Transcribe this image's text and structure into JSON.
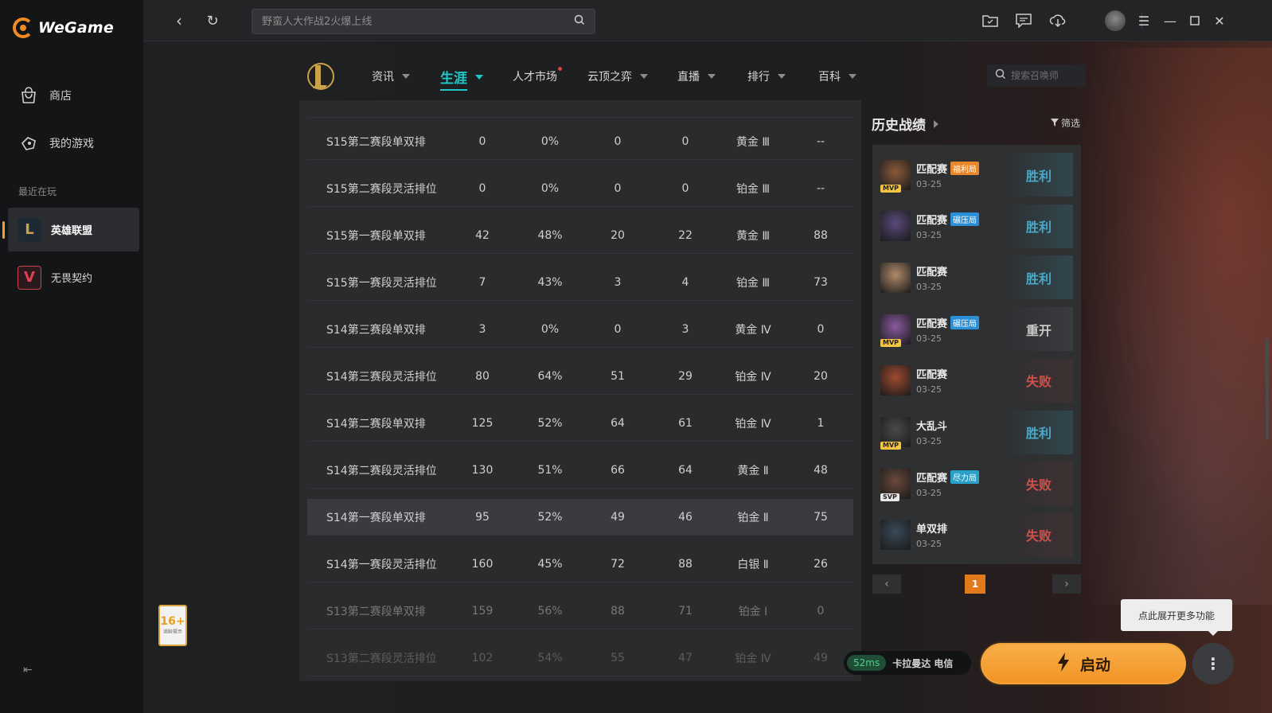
{
  "app": {
    "logo_text": "WeGame"
  },
  "sidebar": {
    "items": [
      {
        "label": "商店",
        "icon": "shop-bag-icon"
      },
      {
        "label": "我的游戏",
        "icon": "gamepad-icon"
      }
    ],
    "recent_title": "最近在玩",
    "games": [
      {
        "label": "英雄联盟",
        "icon": "lol-logo-icon",
        "active": true
      },
      {
        "label": "无畏契约",
        "icon": "valorant-logo-icon",
        "active": false
      }
    ]
  },
  "topbar": {
    "search_placeholder": "野蛮人大作战2火爆上线"
  },
  "lol_nav": {
    "tabs": [
      {
        "label": "资讯",
        "active": false
      },
      {
        "label": "生涯",
        "active": true
      },
      {
        "label": "人才市场",
        "active": false,
        "dot": true
      },
      {
        "label": "云顶之弈",
        "active": false
      },
      {
        "label": "直播",
        "active": false
      },
      {
        "label": "排行",
        "active": false
      },
      {
        "label": "百科",
        "active": false
      }
    ],
    "summoner_search_placeholder": "搜索召唤师"
  },
  "ranked_table": {
    "rows": [
      {
        "season": "S15第二赛段单双排",
        "games": "0",
        "winrate": "0%",
        "wins": "0",
        "losses": "0",
        "tier": "黄金 Ⅲ",
        "lp": "--"
      },
      {
        "season": "S15第二赛段灵活排位",
        "games": "0",
        "winrate": "0%",
        "wins": "0",
        "losses": "0",
        "tier": "铂金 Ⅲ",
        "lp": "--"
      },
      {
        "season": "S15第一赛段单双排",
        "games": "42",
        "winrate": "48%",
        "wins": "20",
        "losses": "22",
        "tier": "黄金 Ⅲ",
        "lp": "88"
      },
      {
        "season": "S15第一赛段灵活排位",
        "games": "7",
        "winrate": "43%",
        "wins": "3",
        "losses": "4",
        "tier": "铂金 Ⅲ",
        "lp": "73"
      },
      {
        "season": "S14第三赛段单双排",
        "games": "3",
        "winrate": "0%",
        "wins": "0",
        "losses": "3",
        "tier": "黄金 Ⅳ",
        "lp": "0"
      },
      {
        "season": "S14第三赛段灵活排位",
        "games": "80",
        "winrate": "64%",
        "wins": "51",
        "losses": "29",
        "tier": "铂金 Ⅳ",
        "lp": "20"
      },
      {
        "season": "S14第二赛段单双排",
        "games": "125",
        "winrate": "52%",
        "wins": "64",
        "losses": "61",
        "tier": "铂金 Ⅳ",
        "lp": "1"
      },
      {
        "season": "S14第二赛段灵活排位",
        "games": "130",
        "winrate": "51%",
        "wins": "66",
        "losses": "64",
        "tier": "黄金 Ⅱ",
        "lp": "48"
      },
      {
        "season": "S14第一赛段单双排",
        "games": "95",
        "winrate": "52%",
        "wins": "49",
        "losses": "46",
        "tier": "铂金 Ⅱ",
        "lp": "75"
      },
      {
        "season": "S14第一赛段灵活排位",
        "games": "160",
        "winrate": "45%",
        "wins": "72",
        "losses": "88",
        "tier": "白银 Ⅱ",
        "lp": "26"
      },
      {
        "season": "S13第二赛段单双排",
        "games": "159",
        "winrate": "56%",
        "wins": "88",
        "losses": "71",
        "tier": "铂金 Ⅰ",
        "lp": "0"
      },
      {
        "season": "S13第二赛段灵活排位",
        "games": "102",
        "winrate": "54%",
        "wins": "55",
        "losses": "47",
        "tier": "铂金 Ⅳ",
        "lp": "49"
      }
    ]
  },
  "history": {
    "title": "历史战绩",
    "filter_label": "筛选",
    "matches": [
      {
        "mode": "匹配赛",
        "tag": "福利局",
        "tag_color": "#e8862a",
        "date": "03-25",
        "badge": "MVP",
        "result": "胜利",
        "result_type": "win",
        "champ_color": "#8a5a3a"
      },
      {
        "mode": "匹配赛",
        "tag": "碾压局",
        "tag_color": "#2a8fd6",
        "date": "03-25",
        "badge": "",
        "result": "胜利",
        "result_type": "win",
        "champ_color": "#5a4a7a"
      },
      {
        "mode": "匹配赛",
        "tag": "",
        "tag_color": "",
        "date": "03-25",
        "badge": "",
        "result": "胜利",
        "result_type": "win",
        "champ_color": "#b08a6a"
      },
      {
        "mode": "匹配赛",
        "tag": "碾压局",
        "tag_color": "#2a8fd6",
        "date": "03-25",
        "badge": "MVP",
        "result": "重开",
        "result_type": "remake",
        "champ_color": "#8a5aa0"
      },
      {
        "mode": "匹配赛",
        "tag": "",
        "tag_color": "",
        "date": "03-25",
        "badge": "",
        "result": "失败",
        "result_type": "loss",
        "champ_color": "#a04a30"
      },
      {
        "mode": "大乱斗",
        "tag": "",
        "tag_color": "",
        "date": "03-25",
        "badge": "MVP",
        "result": "胜利",
        "result_type": "win",
        "champ_color": "#4a4a4a"
      },
      {
        "mode": "匹配赛",
        "tag": "尽力局",
        "tag_color": "#2aa0c8",
        "date": "03-25",
        "badge": "SVP",
        "result": "失败",
        "result_type": "loss",
        "champ_color": "#6a4a3a"
      },
      {
        "mode": "单双排",
        "tag": "",
        "tag_color": "",
        "date": "03-25",
        "badge": "",
        "result": "失败",
        "result_type": "loss",
        "champ_color": "#3a4a5a"
      }
    ],
    "page": "1"
  },
  "footer": {
    "age_rating": "16+",
    "age_sub": "适龄提示",
    "ping": "52ms",
    "server": "卡拉曼达 电信",
    "launch_label": "启动",
    "tooltip": "点此展开更多功能"
  },
  "colors": {
    "accent_teal": "#20c8c8",
    "win_text": "#4aa8c8",
    "win_bg": "#30464d",
    "loss_text": "#d0504a",
    "loss_bg": "#3e3132",
    "remake_text": "#c8c8c8",
    "remake_bg": "#3a3b3e",
    "launch_orange": "#f29324"
  }
}
